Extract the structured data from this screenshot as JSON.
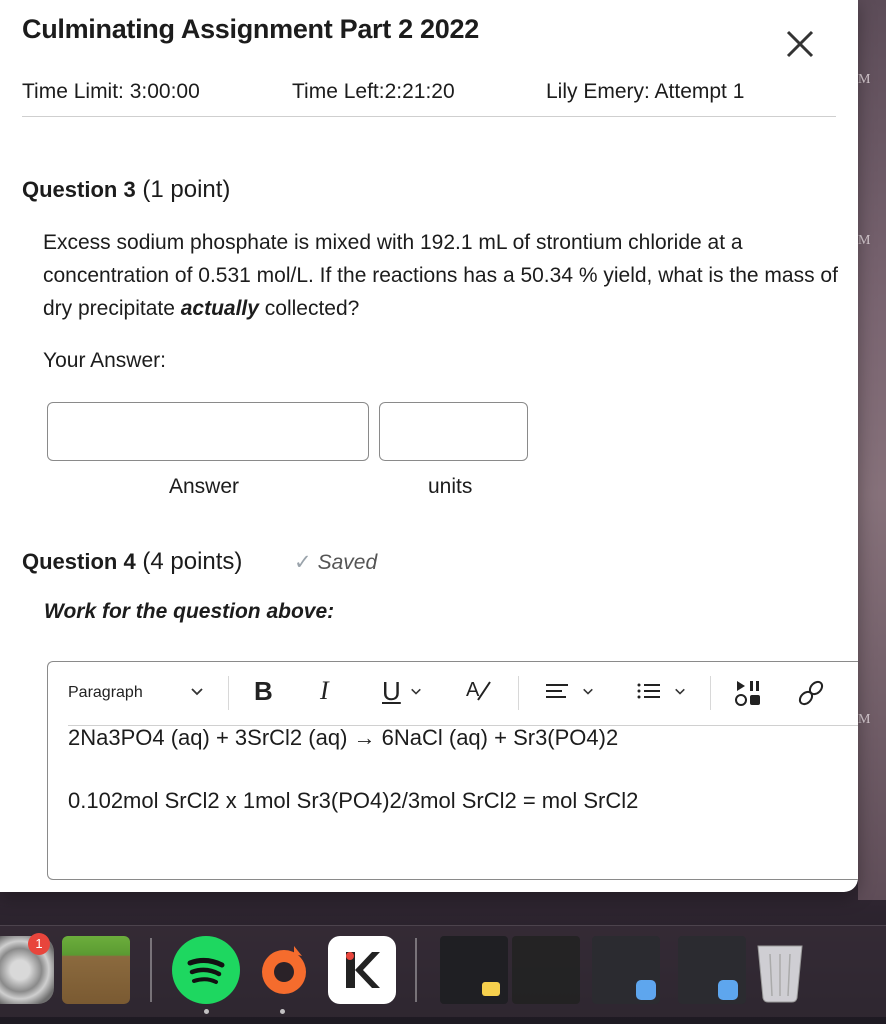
{
  "dialog": {
    "title": "Culminating Assignment Part 2 2022",
    "close_glyph": "✕",
    "time_limit": "Time Limit: 3:00:00",
    "time_left": "Time Left:2:21:20",
    "attempt": "Lily Emery: Attempt 1"
  },
  "side_letter": "M",
  "question3": {
    "number": "Question 3",
    "points": "(1 point)",
    "text_part1": "Excess sodium phosphate is mixed with 192.1 mL of strontium chloride at a concentration of 0.531 mol/L. If the reactions has a 50.34 % yield, what is the mass of dry precipitate ",
    "text_emphasis": "actually",
    "text_part2": " collected?",
    "your_answer_label": "Your Answer:",
    "answer_value": "",
    "units_value": "",
    "answer_label": "Answer",
    "units_label": "units"
  },
  "question4": {
    "number": "Question 4",
    "points": "(4 points)",
    "saved_check": "✓",
    "saved_label": "Saved",
    "work_label": "Work for the question above:"
  },
  "editor": {
    "toolbar": {
      "format_label": "Paragraph",
      "bold": "B",
      "italic": "I",
      "underline": "U",
      "font_color": "A",
      "align": "≡",
      "list": "☰",
      "chevron": "⌄"
    },
    "lines": [
      "2Na3PO4 (aq) + 3SrCl2 (aq) → 6NaCl (aq) + Sr3(PO4)2",
      "0.102mol SrCl2 x 1mol Sr3(PO4)2/3mol SrCl2 = mol SrCl2"
    ]
  },
  "dock": {
    "badge_count": "1",
    "icons": [
      "settings-icon",
      "minecraft-icon",
      "spotify-icon",
      "origin-icon",
      "kahoot-icon",
      "notes-window-icon",
      "finder-window-icon",
      "finder-window-icon-2",
      "trash-icon"
    ]
  }
}
